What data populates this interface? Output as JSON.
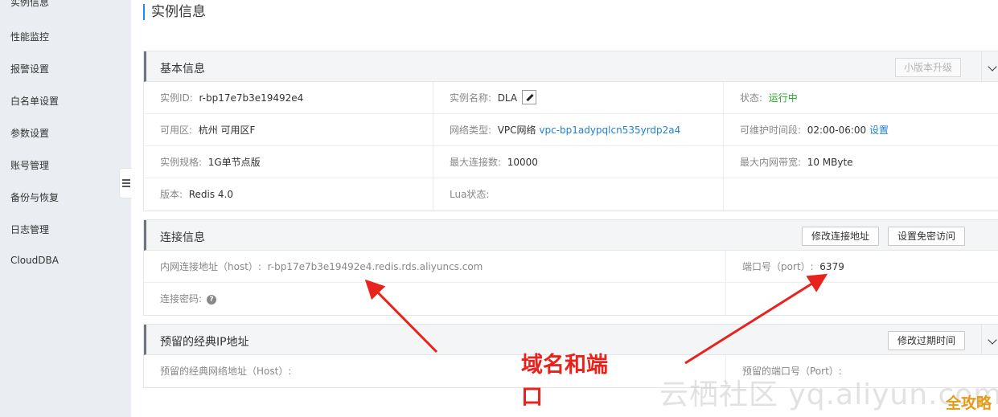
{
  "sidebar": {
    "items": [
      "实例信息",
      "性能监控",
      "报警设置",
      "白名单设置",
      "参数设置",
      "账号管理",
      "备份与恢复",
      "日志管理",
      "CloudDBA"
    ]
  },
  "page_title": "实例信息",
  "basic": {
    "title": "基本信息",
    "upgrade_button": "小版本升级",
    "instance_id_label": "实例ID:",
    "instance_id": "r-bp17e7b3e19492e4",
    "instance_name_label": "实例名称:",
    "instance_name": "DLA",
    "status_label": "状态:",
    "status": "运行中",
    "zone_label": "可用区:",
    "zone": "杭州 可用区F",
    "network_label": "网络类型:",
    "network_type": "VPC网络",
    "vpc_id": "vpc-bp1adypqlcn535yrdp2a4",
    "maint_label": "可维护时间段:",
    "maint_time": "02:00-06:00",
    "maint_link": "设置",
    "spec_label": "实例规格:",
    "spec": "1G单节点版",
    "maxconn_label": "最大连接数:",
    "maxconn": "10000",
    "bandwidth_label": "最大内网带宽:",
    "bandwidth": "10 MByte",
    "version_label": "版本:",
    "version": "Redis 4.0",
    "lua_label": "Lua状态:"
  },
  "conn": {
    "title": "连接信息",
    "modify_button": "修改连接地址",
    "nopass_button": "设置免密访问",
    "host_label": "内网连接地址（host）:",
    "host": "r-bp17e7b3e19492e4.redis.rds.aliyuncs.com",
    "port_label": "端口号（port）:",
    "port": "6379",
    "password_label": "连接密码:",
    "help_glyph": "?"
  },
  "reserved": {
    "title": "预留的经典IP地址",
    "expire_button": "修改过期时间",
    "host_label": "预留的经典网络地址（Host）:",
    "port_label": "预留的端口号（Port）:"
  },
  "annotation": {
    "line1": "域名和端",
    "line2": "口"
  },
  "watermark": {
    "text": "云栖社区 yq.aliyun.com",
    "logo": "全攻略"
  },
  "colors": {
    "accent": "#1f8ee6",
    "status_green": "#2aa52a",
    "annotation_red": "#e8231e",
    "link": "#1f7fd6"
  }
}
